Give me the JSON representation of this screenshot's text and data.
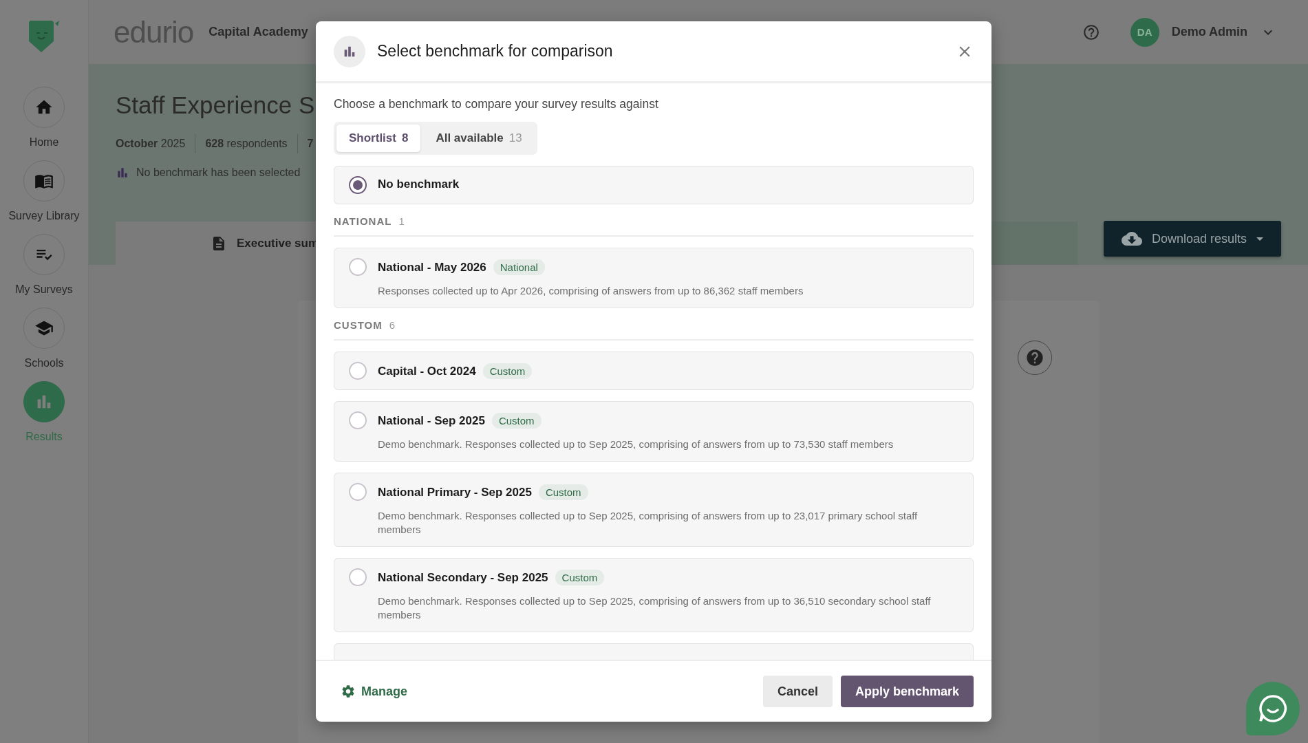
{
  "sidebar": {
    "items": [
      {
        "label": "Home",
        "selected": false
      },
      {
        "label": "Survey Library",
        "selected": false
      },
      {
        "label": "My Surveys",
        "selected": false
      },
      {
        "label": "Schools",
        "selected": false
      },
      {
        "label": "Results",
        "selected": true
      }
    ]
  },
  "header": {
    "brand": "edurio",
    "organisation": "Capital Academy",
    "user": {
      "initials": "DA",
      "name": "Demo Admin"
    }
  },
  "report": {
    "title": "Staff Experience S",
    "meta": [
      {
        "strong": "October",
        "text": "2025"
      },
      {
        "strong": "628",
        "text": "respondents"
      },
      {
        "strong": "7"
      }
    ],
    "benchmark_note": "No benchmark has been selected",
    "tabs": [
      {
        "label": "Executive sum",
        "selected": true
      }
    ],
    "download_button": "Download results"
  },
  "modal": {
    "title": "Select benchmark for comparison",
    "subtitle": "Choose a benchmark to compare your survey results against",
    "tabs": [
      {
        "label": "Shortlist",
        "count": "8",
        "selected": true
      },
      {
        "label": "All available",
        "count": "13",
        "selected": false
      }
    ],
    "no_benchmark": {
      "label": "No benchmark",
      "selected": true
    },
    "groups": [
      {
        "heading": "NATIONAL",
        "count": "1",
        "items": [
          {
            "name": "National - May 2026",
            "tag": "National",
            "description": "Responses collected up to Apr 2026, comprising of answers from up to 86,362 staff members",
            "selected": false
          }
        ]
      },
      {
        "heading": "CUSTOM",
        "count": "6",
        "items": [
          {
            "name": "Capital - Oct 2024",
            "tag": "Custom",
            "selected": false
          },
          {
            "name": "National - Sep 2025",
            "tag": "Custom",
            "description": "Demo benchmark. Responses collected up to Sep 2025, comprising of answers from up to 73,530 staff members",
            "selected": false
          },
          {
            "name": "National Primary - Sep 2025",
            "tag": "Custom",
            "description": "Demo benchmark. Responses collected up to Sep 2025, comprising of answers from up to 23,017 primary school staff members",
            "selected": false
          },
          {
            "name": "National Secondary - Sep 2025",
            "tag": "Custom",
            "description": "Demo benchmark. Responses collected up to Sep 2025, comprising of answers from up to 36,510 secondary school staff members",
            "selected": false
          }
        ]
      }
    ],
    "manage": "Manage",
    "cancel": "Cancel",
    "apply": "Apply benchmark"
  }
}
